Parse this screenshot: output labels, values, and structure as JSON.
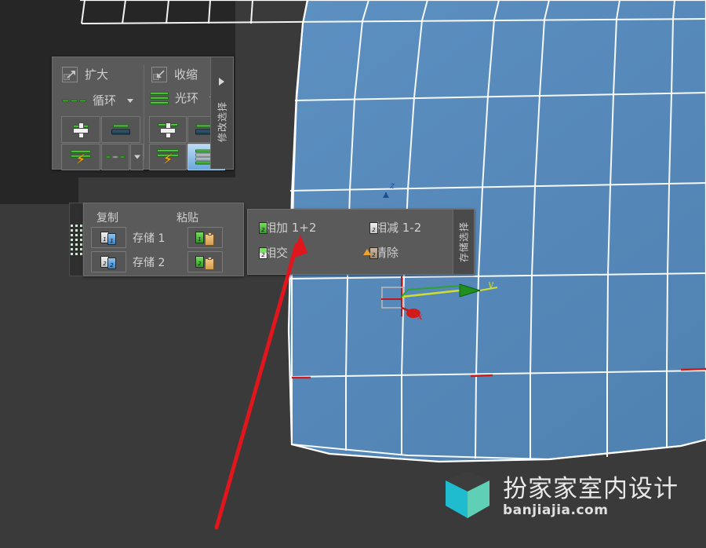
{
  "app": {
    "background_color": "#3a3a3a",
    "panel_color": "#5a5a5a",
    "accent_green": "#49c23a",
    "accent_blue": "#5a8fc0",
    "selection_red": "#e1151c"
  },
  "viewport": {
    "name": "3d-viewport",
    "mesh_fill": "#5a8fc0",
    "wire_color": "#ffffff",
    "gizmo": {
      "z_label": "z",
      "y_label": "y",
      "x_label": "x",
      "z_color": "#1c4f8f",
      "y_color": "#cfe02a",
      "x_color": "#d11a1a"
    }
  },
  "ribbon_panel": {
    "title": "修改选择",
    "expand_arrow": "▶",
    "top_buttons": [
      {
        "label": "扩大",
        "icon": "grow-icon"
      },
      {
        "label": "收缩",
        "icon": "shrink-icon"
      }
    ],
    "groups": [
      {
        "name": "loop",
        "label": "循环",
        "dropdown": "▾",
        "buttons": [
          {
            "icon": "loop-add-icon",
            "selected": false
          },
          {
            "icon": "loop-remove-icon",
            "selected": false
          },
          {
            "icon": "loop-bolt-icon",
            "selected": false
          },
          {
            "icon": "loop-dash-icon",
            "selected": false
          }
        ],
        "extra_dropdown": "▾"
      },
      {
        "name": "ring",
        "label": "光环",
        "dropdown": "▾",
        "buttons": [
          {
            "icon": "ring-add-icon",
            "selected": false
          },
          {
            "icon": "ring-remove-icon",
            "selected": false
          },
          {
            "icon": "ring-bolt-icon",
            "selected": false
          },
          {
            "icon": "ring-all-icon",
            "selected": true
          }
        ]
      }
    ]
  },
  "copy_paste_panel": {
    "copy_header": "复制",
    "paste_header": "粘贴",
    "rows": [
      {
        "label": "存储 1",
        "copy_icon": "copy-store-1-icon",
        "paste_icon": "paste-store-1-icon"
      },
      {
        "label": "存储 2",
        "copy_icon": "copy-store-2-icon",
        "paste_icon": "paste-store-2-icon"
      }
    ],
    "grip": "drag-grip"
  },
  "ops_panel": {
    "title": "存储选择",
    "items": [
      {
        "label": "相加 1+2",
        "icon": "add-sets-icon"
      },
      {
        "label": "相减 1-2",
        "icon": "subtract-sets-icon"
      },
      {
        "label": "相交",
        "icon": "intersect-sets-icon"
      },
      {
        "label": "清除",
        "icon": "clear-sets-icon"
      }
    ]
  },
  "annotation": {
    "arrow_color": "#e1151c",
    "points_at": "相加 1+2"
  },
  "watermark": {
    "title": "扮家家室内设计",
    "domain": "banjiajia.com",
    "logo": "cube-logo",
    "cube_top": "#3d3d3d",
    "cube_left": "#1fbcd0",
    "cube_right": "#5fcfb6"
  }
}
